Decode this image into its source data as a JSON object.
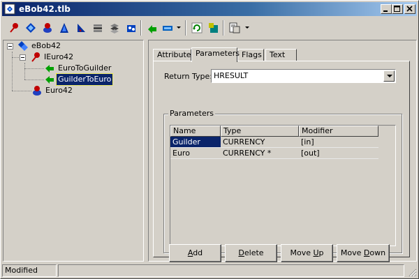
{
  "window": {
    "title": "eBob42.tlb",
    "controls": [
      "minimize-icon",
      "maximize-icon",
      "close-icon"
    ]
  },
  "toolbar": {
    "buttons": [
      {
        "name": "interface-icon",
        "color": "#c00000"
      },
      {
        "name": "dispinterface-icon",
        "color": "#0040c0"
      },
      {
        "name": "coclass-icon",
        "color": "#c00000"
      },
      {
        "name": "enum-icon",
        "color": "#0030a0"
      },
      {
        "name": "alias-icon",
        "color": "#0030a0"
      },
      {
        "name": "record-icon",
        "color": "#404040"
      },
      {
        "name": "union-icon",
        "color": "#404040"
      },
      {
        "name": "module-icon",
        "color": "#0040c0"
      },
      {
        "name": "method-icon",
        "color": "#00a000"
      },
      {
        "name": "property-icon",
        "color": "#0060c0"
      },
      {
        "name": "refresh-icon",
        "color": "#008000"
      },
      {
        "name": "register-icon",
        "color": "#008080"
      },
      {
        "name": "export-icon",
        "color": "#404040"
      }
    ]
  },
  "tree": {
    "root": {
      "label": "eBob42",
      "icon": "library-icon"
    },
    "interface": {
      "label": "IEuro42",
      "icon": "interface-icon"
    },
    "methods": [
      {
        "label": "EuroToGuilder",
        "icon": "method-icon",
        "selected": false
      },
      {
        "label": "GuilderToEuro",
        "icon": "method-icon",
        "selected": true
      }
    ],
    "coclass": {
      "label": "Euro42",
      "icon": "coclass-icon"
    }
  },
  "tabs": [
    {
      "label": "Attributes",
      "active": false
    },
    {
      "label": "Parameters",
      "active": true
    },
    {
      "label": "Flags",
      "active": false
    },
    {
      "label": "Text",
      "active": false
    }
  ],
  "return_type": {
    "label": "Return Type:",
    "value": "HRESULT"
  },
  "parameters": {
    "group_label": "Parameters",
    "columns": [
      "Name",
      "Type",
      "Modifier"
    ],
    "rows": [
      {
        "name": "Guilder",
        "type": "CURRENCY",
        "modifier": "[in]",
        "selected": true
      },
      {
        "name": "Euro",
        "type": "CURRENCY *",
        "modifier": "[out]",
        "selected": false
      }
    ]
  },
  "buttons": {
    "add": {
      "pre": "",
      "key": "A",
      "post": "dd"
    },
    "delete": {
      "pre": "",
      "key": "D",
      "post": "elete"
    },
    "move_up": {
      "pre": "Move ",
      "key": "U",
      "post": "p"
    },
    "move_down": {
      "pre": "Move ",
      "key": "D",
      "post": "own"
    }
  },
  "status": {
    "text": "Modified"
  },
  "colors": {
    "face": "#d4d0c8",
    "selection": "#0a246a",
    "title_start": "#0a246a",
    "title_end": "#a6caf0"
  }
}
